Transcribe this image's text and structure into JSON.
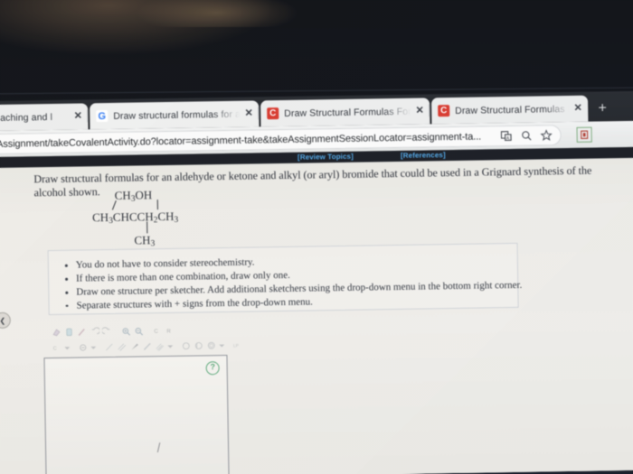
{
  "browser": {
    "tabs": [
      {
        "title": "ne teaching and l",
        "favicon": "generic-favicon",
        "close": "✕"
      },
      {
        "title": "Draw structural formulas for a",
        "favicon": "google-icon",
        "close": "✕"
      },
      {
        "title": "Draw Structural Formulas For A",
        "favicon": "cengage-icon",
        "close": "✕"
      },
      {
        "title": "Draw Structural Formulas For A",
        "favicon": "cengage-icon",
        "close": "✕"
      }
    ],
    "new_tab_label": "+",
    "url": "n/takeAssignment/takeCovalentActivity.do?locator=assignment-take&takeAssignmentSessionLocator=assignment-ta...",
    "omnibox_icons": [
      "translate-icon",
      "search-icon",
      "bookmark-star-icon"
    ],
    "extension_icon": "extension-icon"
  },
  "topbar": {
    "review_topics": "[Review Topics]",
    "references": "[References]",
    "link_color": "#4fa7e8",
    "background": "#15181f"
  },
  "question": {
    "prompt": "Draw structural formulas for an aldehyde or ketone and alkyl (or aryl) bromide that could be used in a Grignard synthesis of the alcohol shown.",
    "structure": {
      "top_row": "CH3OH",
      "middle_row": "CH3CHCCH2CH3",
      "bottom_row": "CH3",
      "top_row_parts": [
        {
          "t": "CH"
        },
        {
          "sub": "3"
        },
        {
          "t": "OH"
        }
      ],
      "middle_row_parts": [
        {
          "t": "CH"
        },
        {
          "sub": "3"
        },
        {
          "t": "CHCCH"
        },
        {
          "sub": "2"
        },
        {
          "t": "CH"
        },
        {
          "sub": "3"
        }
      ],
      "bottom_row_parts": [
        {
          "t": "CH"
        },
        {
          "sub": "3"
        }
      ]
    }
  },
  "notes": [
    "You do not have to consider stereochemistry.",
    "If there is more than one combination, draw only one.",
    "Draw one structure per sketcher. Add additional sketchers using the drop-down menu in the bottom right corner.",
    "Separate structures with + signs from the drop-down menu."
  ],
  "sketcher": {
    "toolbar_row_1": [
      "eraser-icon",
      "lasso-select-icon",
      "pencil-icon",
      "undo-icon",
      "redo-icon",
      "zoom-in-icon",
      "zoom-out-icon",
      "carbon-atom-icon",
      "heteroatom-icon"
    ],
    "toolbar_row_2": [
      "atom-label-icon",
      "atom-dropdown-caret",
      "charge-icon",
      "charge-dropdown-caret",
      "single-bond-icon",
      "double-bond-icon",
      "wedge-bond-icon",
      "hash-bond-icon",
      "triple-bond-icon",
      "bond-dropdown-caret",
      "cyclohexane-ring-icon",
      "cyclopentane-ring-icon",
      "benzene-ring-icon",
      "ring-dropdown-caret",
      "template-icon"
    ],
    "help_badge": "?",
    "canvas_placeholder": ""
  },
  "collapse_handle": {
    "glyph": "❮",
    "name": "collapse-panel-chevron"
  }
}
